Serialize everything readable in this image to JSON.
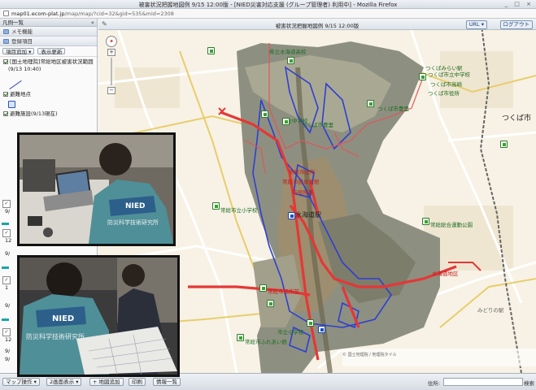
{
  "window": {
    "title": "被害状況把握地図例 9/15 12:00版 - [NIED災害対応支援 (グループ管理者) 利用中] - Mozilla Firefox",
    "controls": "_ □ ×"
  },
  "address": {
    "host": "map01.ecom-plat.jp",
    "path": "/map/map/?cid=32&gid=535&mid=2308"
  },
  "left_panel": {
    "header": "凡例一覧",
    "sections": [
      "メモ機能",
      "登録項目"
    ],
    "toolbar": [
      "項目追加 ▾",
      "表示更新"
    ],
    "layers": [
      {
        "label": "[国土地理院]常総地区被害状況範囲",
        "checked": true
      },
      {
        "label": "(9/13 10:40)",
        "checked": false
      },
      {
        "label": "避難地点",
        "checked": true
      },
      {
        "label": "避難施設(9/13現在)",
        "checked": true
      }
    ],
    "side_numbers": [
      "9/",
      "12",
      "9/",
      "1",
      "9/",
      "12",
      "9/",
      "9/",
      "1"
    ]
  },
  "map": {
    "title": "被害状況把握地図例 9/15 12:00版",
    "url_button": "URL ▾",
    "logout_button": "ログアウト",
    "labels": [
      {
        "text": "つくば市",
        "style": "dark"
      },
      {
        "text": "常総市役所",
        "style": "red"
      },
      {
        "text": "常総市民体育館",
        "style": "red"
      },
      {
        "text": "市役所前",
        "style": "red"
      },
      {
        "text": "つくばみらい駅",
        "style": "green"
      },
      {
        "text": "つくば市立中学校",
        "style": "green"
      },
      {
        "text": "つくば市高崎",
        "style": "green"
      },
      {
        "text": "県立水海道高校",
        "style": "green"
      },
      {
        "text": "常総市立小学校",
        "style": "green"
      },
      {
        "text": "市立中学校",
        "style": "green"
      },
      {
        "text": "常総市役所前",
        "style": "red"
      },
      {
        "text": "つくば市豊里",
        "style": "green"
      },
      {
        "text": "つくば市豊里",
        "style": "green"
      },
      {
        "text": "水海道地区",
        "style": "red"
      },
      {
        "text": "常総総合運動公園",
        "style": "green"
      },
      {
        "text": "みどりの駅",
        "style": "gray"
      },
      {
        "text": "水海道駅",
        "style": "red"
      },
      {
        "text": "つくば市役所",
        "style": "green"
      },
      {
        "text": "市立小学校",
        "style": "green"
      },
      {
        "text": "常総市ふれあい館",
        "style": "green"
      }
    ],
    "attribution": "© 国土地理院 / 地理院タイル"
  },
  "photos": [
    {
      "vest_text": "NIED",
      "vest_sub": "防災科学技術研究所"
    },
    {
      "vest_text": "NIED",
      "vest_sub": "防災科学技術研究所"
    }
  ],
  "statusbar": {
    "buttons": [
      "マップ操作 ▾",
      "2画面表示 ▾",
      "+ 地図追加",
      "印刷",
      "情報一覧"
    ],
    "address_label": "住所:",
    "search_label": "検索"
  },
  "colors": {
    "flood_outline": "#2f3fd1",
    "river_outline": "#e0565a",
    "road_red": "#e53737",
    "poi_green": "#36a32f"
  }
}
